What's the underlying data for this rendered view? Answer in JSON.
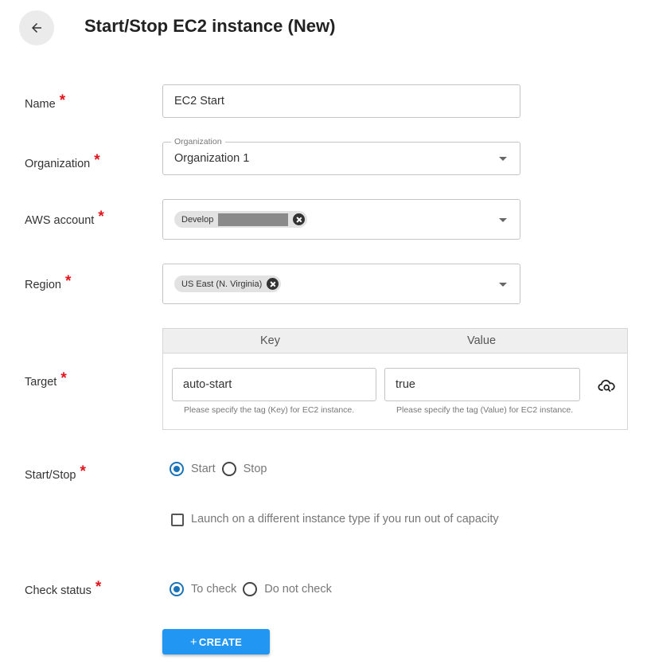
{
  "header": {
    "title": "Start/Stop EC2 instance (New)"
  },
  "form": {
    "required_mark": "*",
    "name": {
      "label": "Name",
      "value": "EC2 Start"
    },
    "organization": {
      "label": "Organization",
      "legend": "Organization",
      "value": "Organization 1"
    },
    "aws_account": {
      "label": "AWS account",
      "chip": "Develop"
    },
    "region": {
      "label": "Region",
      "chip": "US East (N. Virginia)"
    },
    "target": {
      "label": "Target",
      "key_header": "Key",
      "value_header": "Value",
      "key_value": "auto-start",
      "value_value": "true",
      "key_helper": "Please specify the tag (Key) for EC2 instance.",
      "value_helper": "Please specify the tag (Value) for EC2 instance."
    },
    "start_stop": {
      "label": "Start/Stop",
      "options": [
        "Start",
        "Stop"
      ],
      "selected": "Start"
    },
    "launch_checkbox": {
      "label": "Launch on a different instance type if you run out of capacity",
      "checked": false
    },
    "check_status": {
      "label": "Check status",
      "options": [
        "To check",
        "Do not check"
      ],
      "selected": "To check"
    },
    "create_button": {
      "plus": "+",
      "label": "CREATE"
    }
  },
  "colors": {
    "primary": "#2196f3",
    "radio_selected": "#1a73b8",
    "required": "#e1141c"
  }
}
